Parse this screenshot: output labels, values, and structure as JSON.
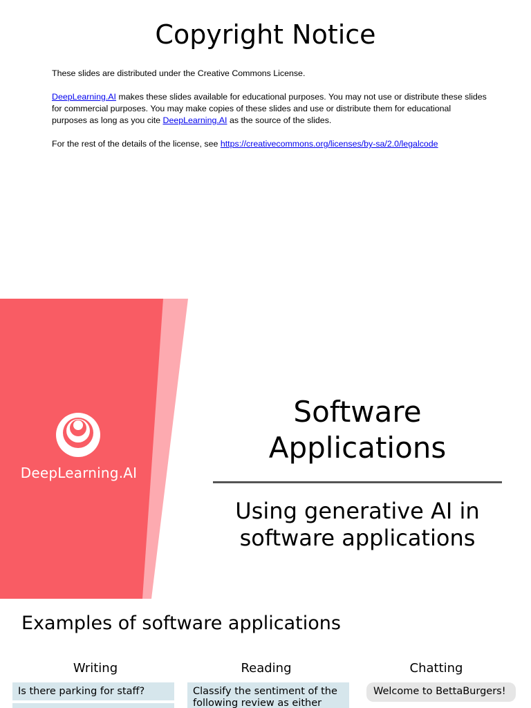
{
  "copyright": {
    "title": "Copyright Notice",
    "line1": "These slides are distributed under the Creative Commons License.",
    "para2_link1": "DeepLearning.AI",
    "para2_text1": " makes these slides available for educational purposes. You may not use or distribute these slides for commercial purposes. You may make copies of these slides and use or distribute them for educational purposes as long as you cite ",
    "para2_link2": "DeepLearning.AI",
    "para2_text2": " as the source of the slides.",
    "para3_text": "For the rest of the details of the license, see ",
    "para3_link": "https://creativecommons.org/licenses/by-sa/2.0/legalcode",
    "link_color": "#0000ee"
  },
  "title_slide": {
    "brand": "DeepLearning.AI",
    "title": "Software Applications",
    "subtitle": "Using generative AI in software applications",
    "accent_color": "#f95c64",
    "accent_light": "#fdaab0"
  },
  "examples_slide": {
    "title": "Examples of software applications",
    "columns": [
      {
        "heading": "Writing",
        "example": "Is there parking for staff?"
      },
      {
        "heading": "Reading",
        "example": "Classify the sentiment of the following review as either"
      },
      {
        "heading": "Chatting",
        "example": "Welcome to BettaBurgers!"
      }
    ],
    "card_color": "#d6e6ec",
    "bubble_color": "#e6e6e6"
  }
}
